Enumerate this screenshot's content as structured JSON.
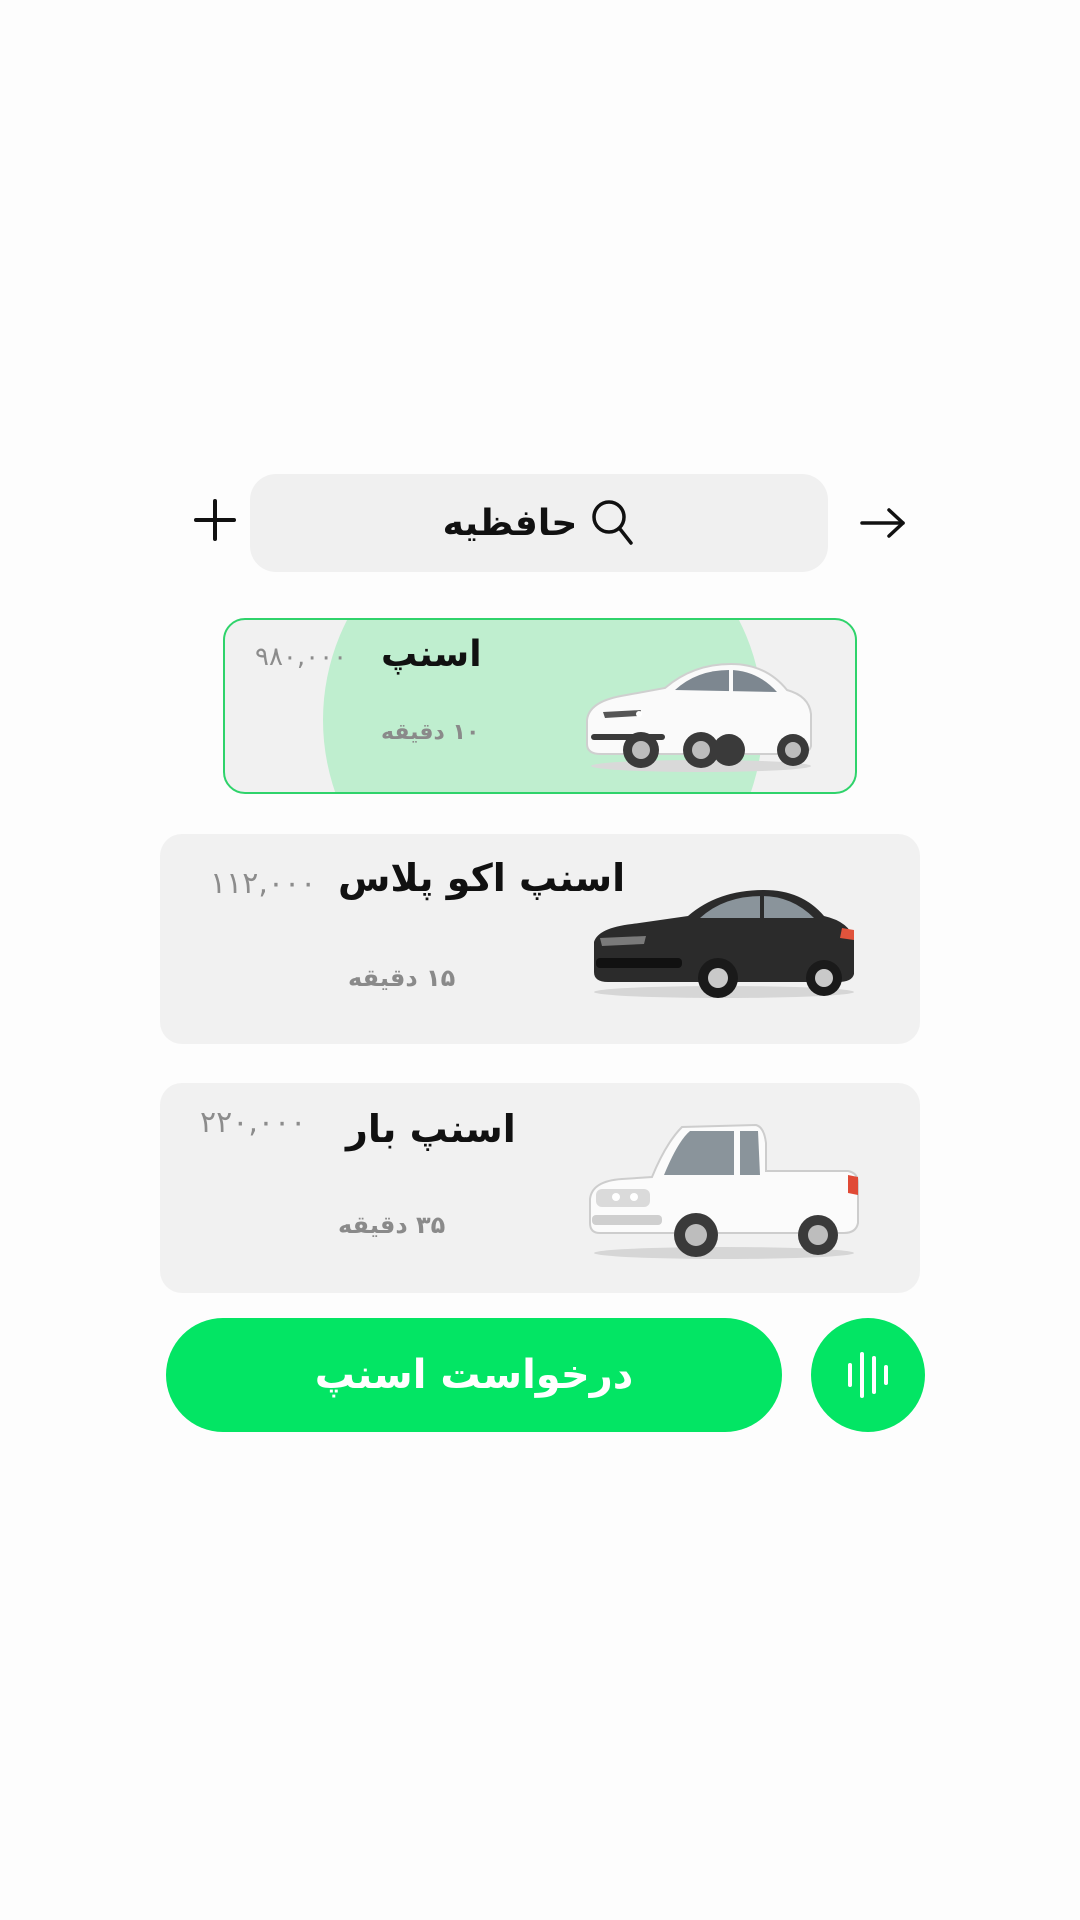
{
  "search": {
    "destination": "حافظیه",
    "icon": "search-icon"
  },
  "top_bar": {
    "add_icon": "plus-icon",
    "back_icon": "arrow-right-icon"
  },
  "rides": [
    {
      "name": "اسنپ",
      "price": "۹۸۰,۰۰۰",
      "eta": "۱۰ دقیقه",
      "selected": true,
      "vehicle": "white-sedan"
    },
    {
      "name": "اسنپ اکو پلاس",
      "price": "۱۱۲,۰۰۰",
      "eta": "۱۵ دقیقه",
      "selected": false,
      "vehicle": "black-sedan"
    },
    {
      "name": "اسنپ بار",
      "price": "۲۲۰,۰۰۰",
      "eta": "۳۵ دقیقه",
      "selected": false,
      "vehicle": "white-pickup"
    }
  ],
  "actions": {
    "request_label": "درخواست اسنپ",
    "voice_icon": "voice-waveform-icon"
  },
  "colors": {
    "accent": "#03e564",
    "selected_border": "#2fd36b",
    "selected_glow": "#bfeecf",
    "card_bg": "#f1f1f1"
  }
}
